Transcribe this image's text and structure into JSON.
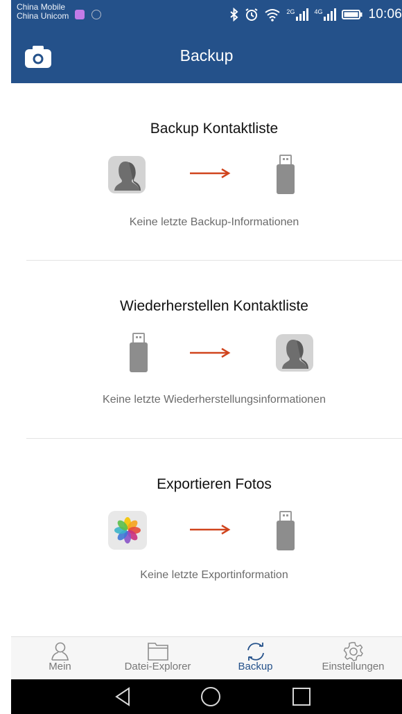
{
  "status_bar": {
    "carrier_1": "China Mobile",
    "carrier_2": "China Unicom",
    "network_2g": "2G",
    "network_4g": "4G",
    "time": "10:06"
  },
  "header": {
    "title": "Backup",
    "accent_color": "#24518a"
  },
  "sections": [
    {
      "title": "Backup Kontaktliste",
      "info": "Keine letzte Backup-Informationen",
      "from_icon": "contact-icon",
      "to_icon": "usb-drive-icon"
    },
    {
      "title": "Wiederherstellen Kontaktliste",
      "info": "Keine letzte Wiederherstellungsinformationen",
      "from_icon": "usb-drive-icon",
      "to_icon": "contact-icon"
    },
    {
      "title": "Exportieren Fotos",
      "info": "Keine letzte Exportinformation",
      "from_icon": "photos-icon",
      "to_icon": "usb-drive-icon"
    }
  ],
  "arrow_color": "#d0441d",
  "tabs": [
    {
      "label": "Mein",
      "icon": "person-icon",
      "active": false
    },
    {
      "label": "Datei-Explorer",
      "icon": "folder-icon",
      "active": false
    },
    {
      "label": "Backup",
      "icon": "sync-icon",
      "active": true
    },
    {
      "label": "Einstellungen",
      "icon": "gear-icon",
      "active": false
    }
  ],
  "nav_buttons": [
    "back-icon",
    "home-icon",
    "recents-icon"
  ]
}
